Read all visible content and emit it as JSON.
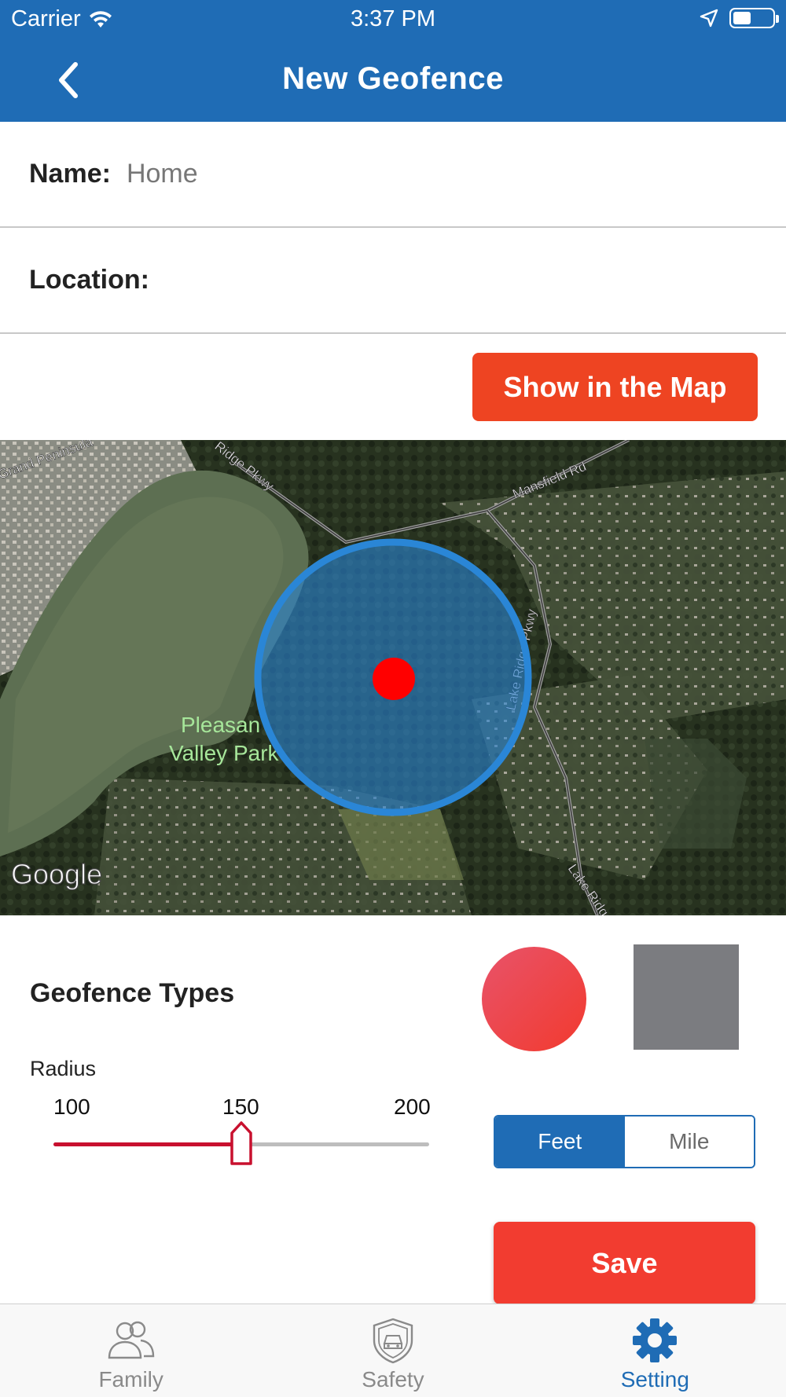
{
  "status_bar": {
    "carrier": "Carrier",
    "time": "3:37 PM",
    "battery_level": 0.45,
    "icons": [
      "wifi-icon",
      "location-arrow-icon",
      "battery-icon"
    ]
  },
  "header": {
    "title": "New Geofence",
    "back_icon": "chevron-left-icon",
    "background_color": "#1f6cb5"
  },
  "form": {
    "name_label": "Name:",
    "name_value": "Home",
    "location_label": "Location:",
    "location_value": "",
    "show_map_label": "Show in the Map"
  },
  "map": {
    "labels": {
      "road_1": "Grand Peninsula",
      "road_2": "Ridge Pkwy",
      "road_3": "Mansfield Rd",
      "road_4": "Lake Ridge Pkwy",
      "road_5": "Lake Ridge",
      "park": "Pleasant Valley Park",
      "park_line_1": "Pleasan",
      "park_line_2": "Valley Park",
      "logo": "Google"
    },
    "geofence_color": "#2a86d6",
    "marker_color": "#ff0000"
  },
  "geofence_types": {
    "title": "Geofence Types",
    "shapes": [
      "circle",
      "square"
    ],
    "circle_color": "#ee4455",
    "square_color": "#7b7c80"
  },
  "radius": {
    "label": "Radius",
    "min_label": "100",
    "mid_label": "150",
    "max_label": "200",
    "min": 100,
    "max": 200,
    "value": 150,
    "fill_color": "#c8102e"
  },
  "units": {
    "options": [
      "Feet",
      "Mile"
    ],
    "selected": "Feet"
  },
  "save_label": "Save",
  "tabs": [
    {
      "label": "Family",
      "icon": "family-icon",
      "active": false
    },
    {
      "label": "Safety",
      "icon": "shield-car-icon",
      "active": false
    },
    {
      "label": "Setting",
      "icon": "gear-icon",
      "active": true
    }
  ]
}
